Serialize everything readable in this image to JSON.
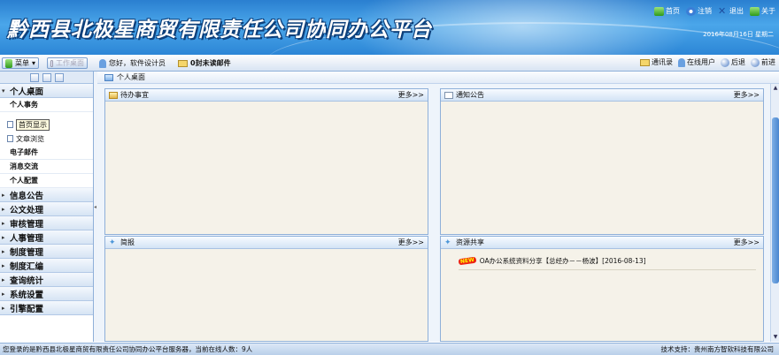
{
  "banner": {
    "title": "黔西县北极星商贸有限责任公司协同办公平台",
    "date": "2016年08月16日 星期二",
    "links": [
      {
        "label": "首页",
        "icon": "home-icon"
      },
      {
        "label": "注销",
        "icon": "logout-icon"
      },
      {
        "label": "退出",
        "icon": "exit-icon"
      },
      {
        "label": "关于",
        "icon": "about-icon"
      }
    ]
  },
  "toolbar": {
    "menu_label": "菜单",
    "desktop_label": "工作桌面",
    "greeting": "您好，软件设计员",
    "unread_mail": "0封未读邮件",
    "right": [
      {
        "label": "通讯录",
        "icon": "address-book-icon"
      },
      {
        "label": "在线用户",
        "icon": "online-users-icon"
      },
      {
        "label": "后退",
        "icon": "back-icon"
      },
      {
        "label": "前进",
        "icon": "forward-icon"
      }
    ]
  },
  "sidebar": {
    "section_personal": "个人桌面",
    "personal_affairs": "个人事务",
    "leaf_home": "首页显示",
    "leaf_browse": "文章浏览",
    "email": "电子邮件",
    "messages": "消息交流",
    "config": "个人配置",
    "sections": [
      "信息公告",
      "公文处理",
      "审核管理",
      "人事管理",
      "制度管理",
      "制度汇编",
      "查询统计",
      "系统设置",
      "引擎配置"
    ]
  },
  "main": {
    "breadcrumb": "个人桌面",
    "more": "更多>>",
    "panels": {
      "todo": "待办事宜",
      "notice": "通知公告",
      "bulletin": "简报",
      "resources": "资源共享"
    },
    "resource_item": "OA办公系统资料分享【总经办－－杨波】[2016-08-13]",
    "new_badge": "NEW"
  },
  "status": {
    "left": "您登录的是黔西县北极星商贸有限责任公司协同办公平台服务器，当前在线人数：9人",
    "right": "技术支持：贵州南方智软科技有限公司"
  },
  "colors": {
    "banner_blue": "#2a7fd0",
    "panel_body": "#f5f2e9",
    "panel_border": "#8fb0d9"
  }
}
